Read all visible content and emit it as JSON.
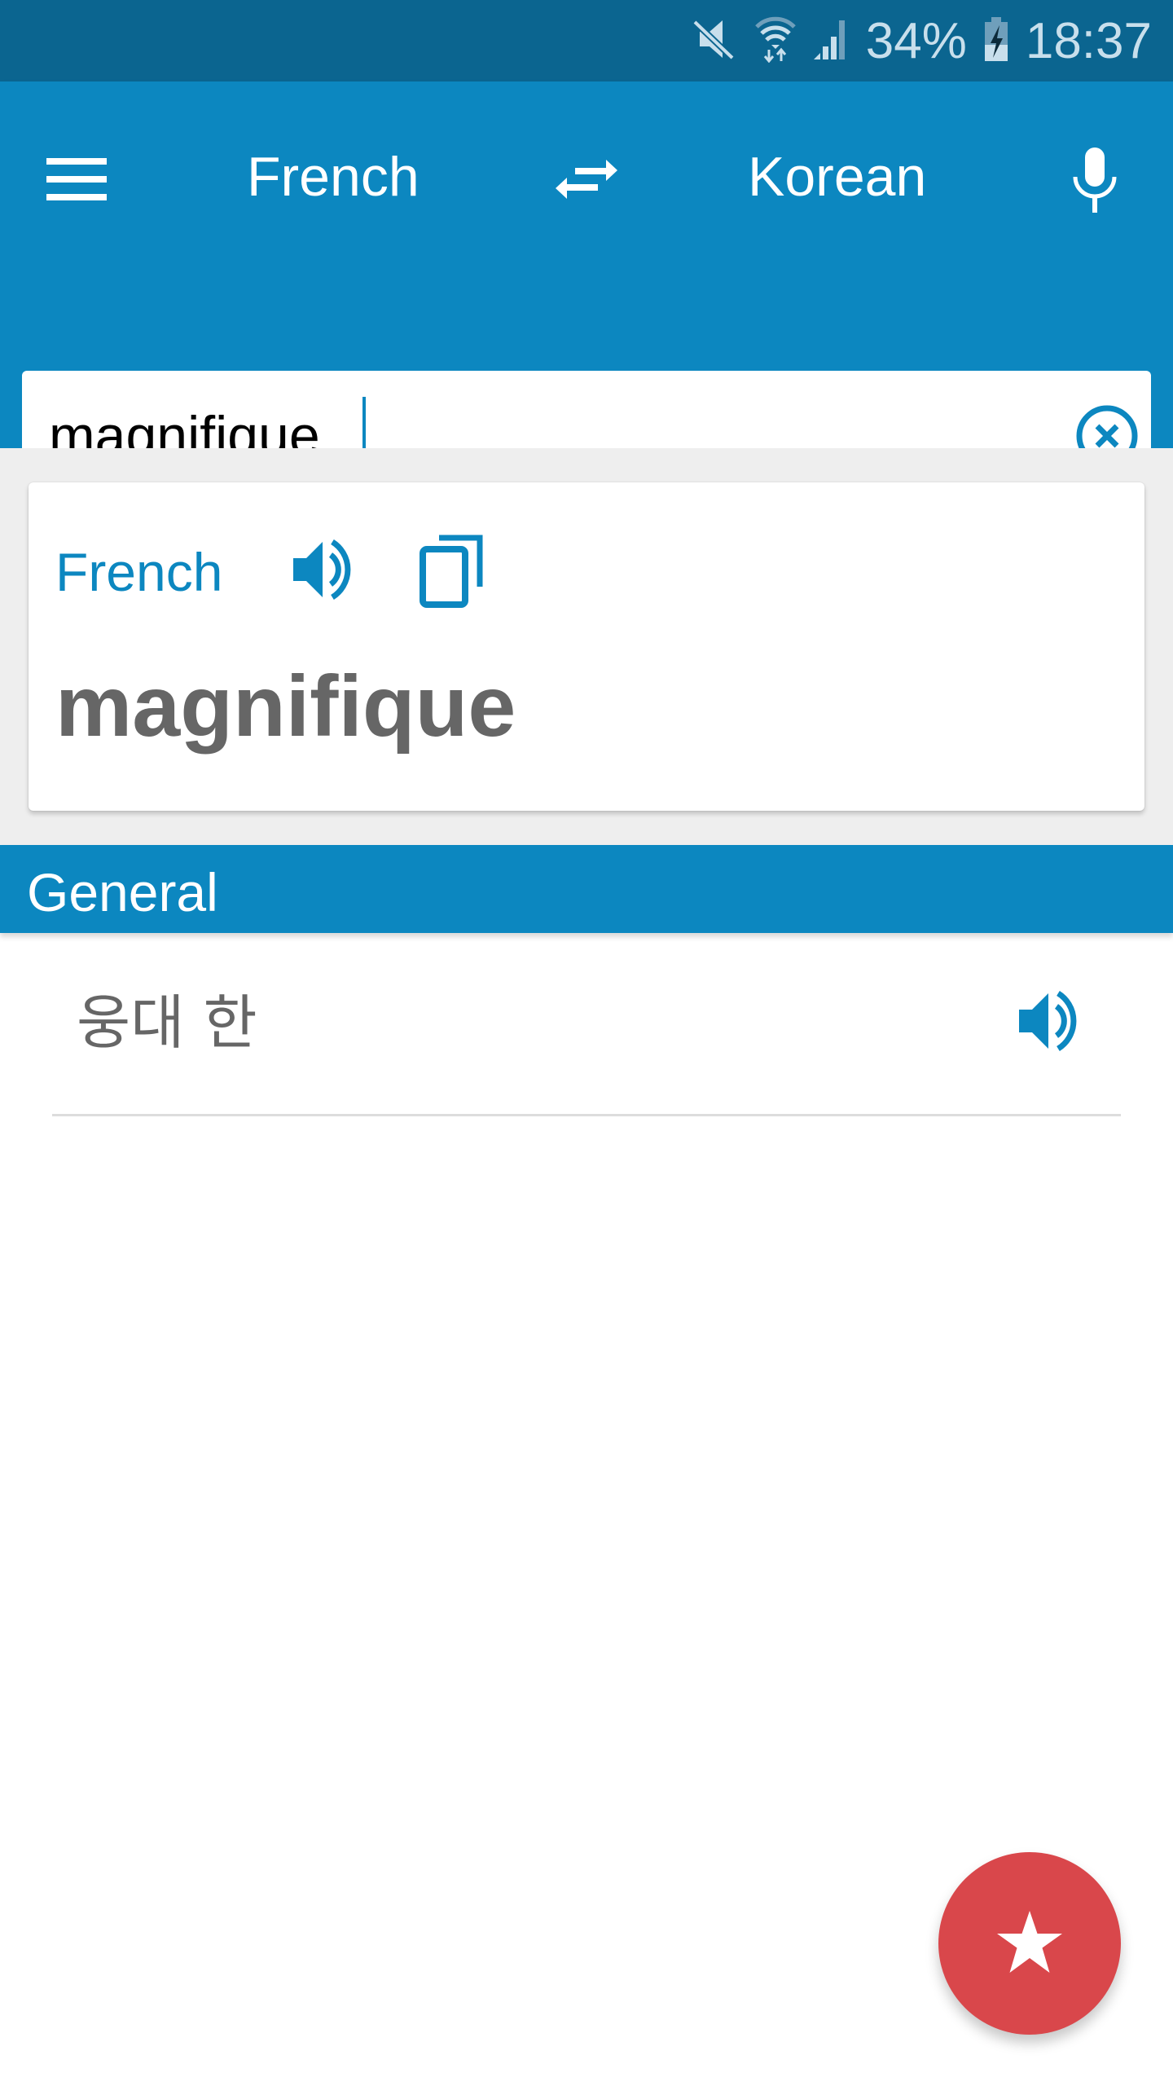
{
  "status_bar": {
    "icons": [
      "mute-icon",
      "wifi-icon",
      "signal-icon",
      "battery-charging-icon"
    ],
    "battery": "34%",
    "time": "18:37"
  },
  "app_bar": {
    "menu_icon": "hamburger-menu-icon",
    "source_language": "French",
    "swap_icon": "swap-arrows-icon",
    "target_language": "Korean",
    "mic_icon": "microphone-icon"
  },
  "search": {
    "value": "magnifique",
    "placeholder": "",
    "clear_icon": "clear-circle-icon"
  },
  "card": {
    "language": "French",
    "speak_icon": "speaker-icon",
    "copy_icon": "copy-icon",
    "word": "magnifique"
  },
  "section": {
    "title": "General"
  },
  "results": [
    {
      "text": "웅대 한",
      "speak_icon": "speaker-icon"
    }
  ],
  "fab": {
    "icon": "star-icon"
  },
  "colors": {
    "primary": "#0c87c0",
    "status_bar": "#0b6590",
    "accent": "#d9474b",
    "text_gray": "#666666"
  }
}
